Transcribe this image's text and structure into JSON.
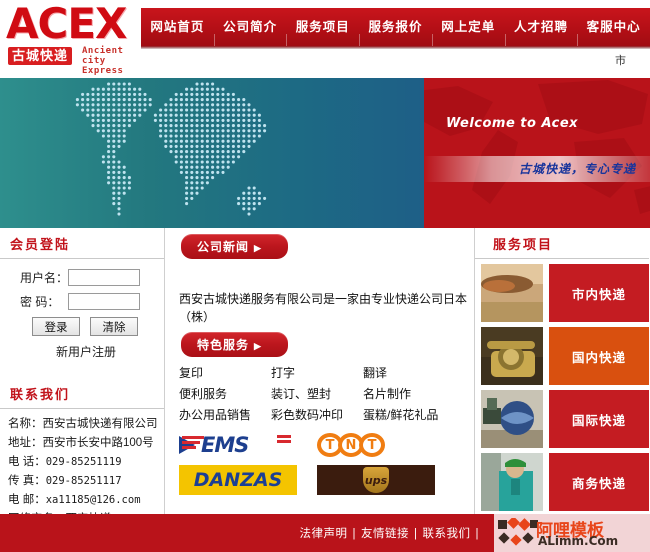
{
  "brand": {
    "logo_main": "ACEX",
    "logo_cn": "古城快递",
    "logo_en_line1": "Ancient city",
    "logo_en_line2": "Express"
  },
  "nav": {
    "items": [
      {
        "label": "网站首页"
      },
      {
        "label": "公司简介"
      },
      {
        "label": "服务项目"
      },
      {
        "label": "服务报价"
      },
      {
        "label": "网上定单"
      },
      {
        "label": "人才招聘"
      },
      {
        "label": "客服中心"
      }
    ],
    "corner_mark": "市"
  },
  "banner": {
    "welcome": "Welcome to  Acex",
    "slogan": "古城快递，专心专递"
  },
  "login": {
    "title": "会员登陆",
    "username_label": "用户名：",
    "username_value": "",
    "username_placeholder": "",
    "password_label": "密  码：",
    "password_value": "",
    "password_placeholder": "",
    "submit_label": "登录",
    "clear_label": "清除",
    "register_label": "新用户注册"
  },
  "contact": {
    "title": "联系我们",
    "items": [
      {
        "label": "名称：",
        "value": "西安古城快递有限公司",
        "mono": false
      },
      {
        "label": "地址：",
        "value": "西安市长安中路100号",
        "mono": false
      },
      {
        "label": "电 话：",
        "value": "029-85251119",
        "mono": true
      },
      {
        "label": "传 真：",
        "value": "029-85251117",
        "mono": true
      },
      {
        "label": "电 邮：",
        "value": "xa11185@126.com",
        "mono": true
      },
      {
        "label": "网络实名：",
        "value": "西安快递",
        "mono": false
      }
    ]
  },
  "main": {
    "news_button": "公司新闻",
    "news_arrow": "▶",
    "intro": "西安古城快递服务有限公司是一家由专业快递公司日本（株）",
    "feature_button": "特色服务",
    "feature_arrow": "▶",
    "services_grid": [
      [
        "复印",
        "打字",
        "翻译"
      ],
      [
        "便利服务",
        "装订、塑封",
        "名片制作"
      ],
      [
        "办公用品销售",
        "彩色数码冲印",
        "蛋糕/鲜花礼品"
      ]
    ],
    "partners": [
      {
        "name": "EMS",
        "text": "EMS"
      },
      {
        "name": "TNT",
        "text": "TNT"
      },
      {
        "name": "DANZAS",
        "text": "DANZAS"
      },
      {
        "name": "UPS",
        "text": "ups"
      }
    ]
  },
  "services_panel": {
    "title": "服务项目",
    "items": [
      {
        "label": "市内快递",
        "color": "#c41c22"
      },
      {
        "label": "国内快递",
        "color": "#d9500f"
      },
      {
        "label": "国际快递",
        "color": "#c41c22"
      },
      {
        "label": "商务快递",
        "color": "#c41c22"
      }
    ]
  },
  "footer": {
    "links": [
      "法律声明",
      "友情链接",
      "联系我们"
    ],
    "trailing_sep": "|",
    "watermark_cn": "阿哩模板",
    "watermark_en": "ALimm.Com"
  },
  "colors": {
    "brand_red": "#b9131a",
    "nav_red": "#bb161d",
    "accent_orange": "#d9500f",
    "banner_teal": "#2e8f8d",
    "banner_blue": "#1e5f87"
  }
}
